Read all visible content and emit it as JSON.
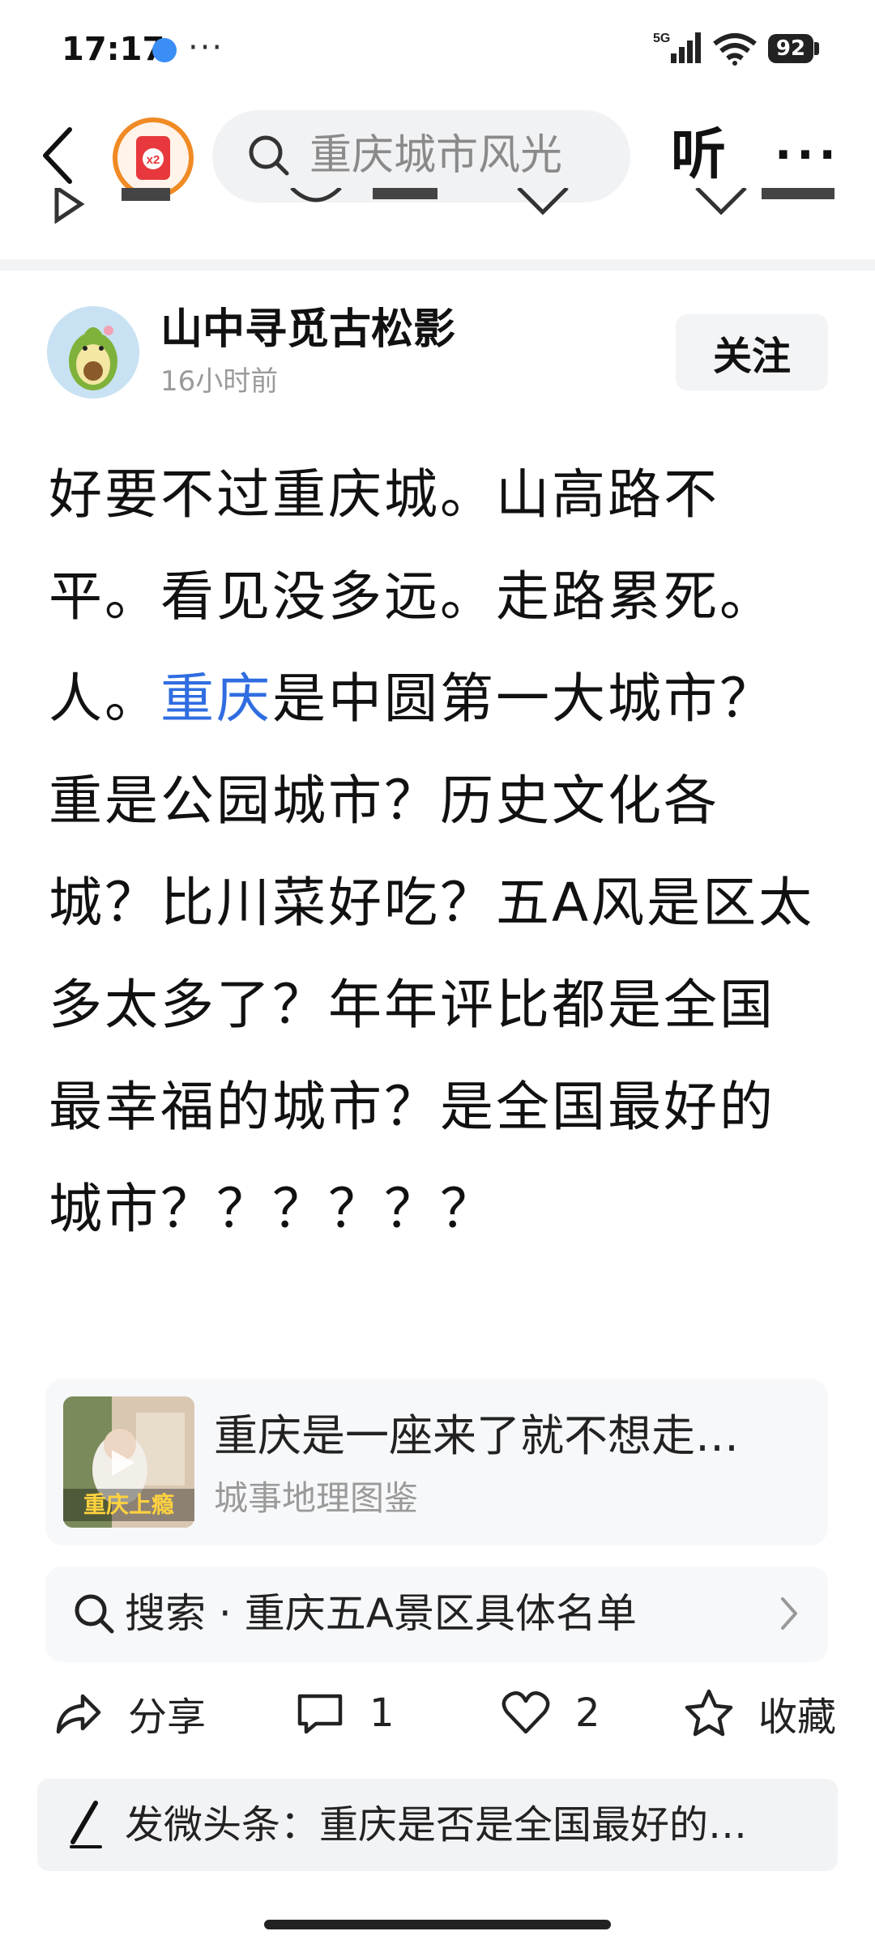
{
  "status_bar": {
    "time": "17:17",
    "network": "5G",
    "battery": "92"
  },
  "header": {
    "search_placeholder": "重庆城市风光",
    "listen_label": "听",
    "badge_label": "x2"
  },
  "author": {
    "name": "山中寻觅古松影",
    "time_ago": "16小时前",
    "follow_label": "关注"
  },
  "post": {
    "text_before_link": "好要不过重庆城。山高路不平。看见没多远。走路累死。人。",
    "link_text": "重庆",
    "text_after_link": "是中圆第一大城市？重是公园城市？历史文化各城？比川菜好吃？五A风是区太多太多了？年年评比都是全国最幸福的城市？是全国最好的城市？？？？？？"
  },
  "related": {
    "title": "重庆是一座来了就不想走…",
    "source": "城事地理图鉴",
    "thumb_label": "重庆上瘾"
  },
  "search_suggestion": {
    "prefix": "搜索",
    "dot": "·",
    "query": "重庆五A景区具体名单"
  },
  "actions": {
    "share": "分享",
    "comment_count": "1",
    "like_count": "2",
    "favorite": "收藏"
  },
  "compose": {
    "text": "发微头条：重庆是否是全国最好的…"
  },
  "colors": {
    "link": "#2f6de1",
    "badge_ring": "#f08a24",
    "badge_fill": "#e8383d"
  }
}
